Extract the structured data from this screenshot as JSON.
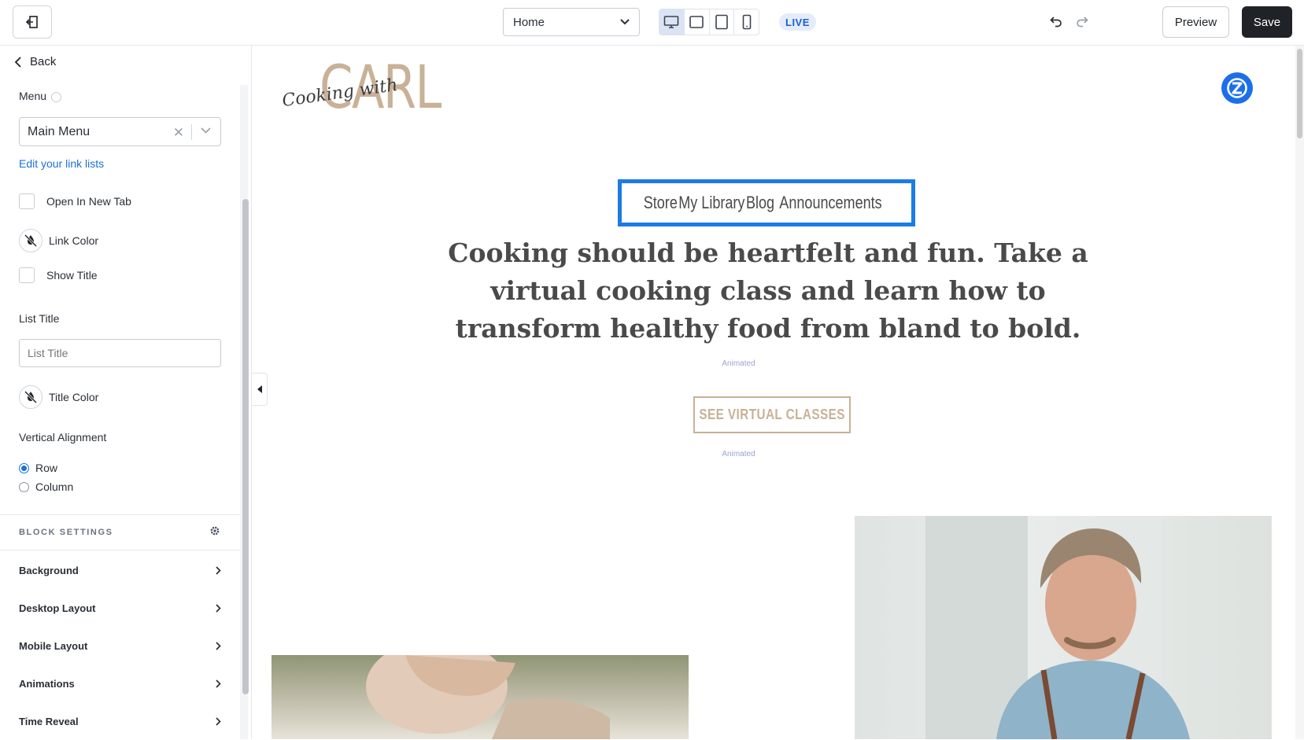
{
  "topbar": {
    "page_select_value": "Home",
    "live_badge": "LIVE",
    "preview_label": "Preview",
    "save_label": "Save"
  },
  "sidebar": {
    "back_label": "Back",
    "menu_label": "Menu",
    "menu_value": "Main Menu",
    "edit_link": "Edit your link lists",
    "open_new_tab": "Open In New Tab",
    "link_color": "Link Color",
    "show_title": "Show Title",
    "list_title_label": "List Title",
    "list_title_placeholder": "List Title",
    "title_color": "Title Color",
    "vertical_alignment": "Vertical Alignment",
    "alignment_options": [
      "Row",
      "Column"
    ],
    "alignment_selected": "Row",
    "block_settings": "BLOCK SETTINGS",
    "sections": [
      "Background",
      "Desktop Layout",
      "Mobile Layout",
      "Animations",
      "Time Reveal"
    ]
  },
  "canvas": {
    "logo_script": "Cooking with",
    "logo_main": "CARL",
    "nav": [
      "Store",
      "My Library",
      "Blog",
      "Announcements"
    ],
    "hero_text": "Cooking should be heartfelt and fun. Take a virtual cooking class and learn how to transform healthy food from bland to bold.",
    "animated_label": "Animated",
    "cta_label": "SEE VIRTUAL CLASSES"
  },
  "colors": {
    "accent_blue": "#1c7be8",
    "brand_tan": "#c8b196",
    "save_bg": "#1f2328"
  }
}
